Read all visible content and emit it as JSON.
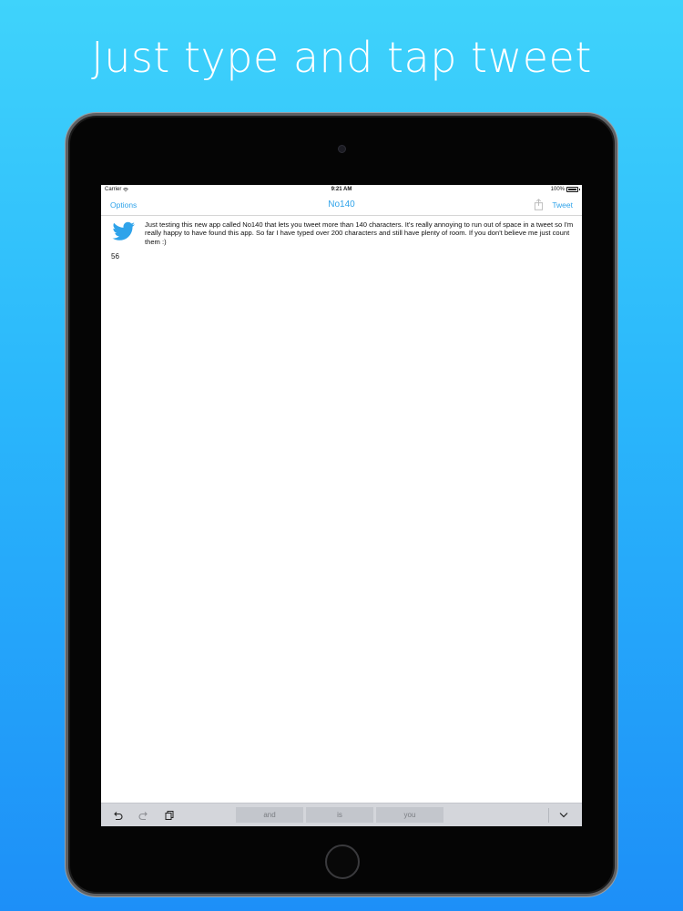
{
  "headline": "Just type and tap tweet",
  "status_bar": {
    "carrier": "Carrier",
    "time": "9:21 AM",
    "battery": "100%"
  },
  "nav_bar": {
    "left_label": "Options",
    "title": "No140",
    "right_label": "Tweet",
    "share_icon": "share-icon"
  },
  "compose": {
    "avatar_icon": "twitter-bird-icon",
    "text": "Just testing this new app called No140 that lets you tweet more than 140 characters. It's really annoying to run out of space in a tweet so I'm really happy to have found this app. So far I have typed over 200 characters and still have plenty of room. If you don't believe me just count them :)",
    "char_count": "56"
  },
  "keyboard_bar": {
    "icons": [
      "undo-icon",
      "redo-icon",
      "paste-icon",
      "chevron-down-icon"
    ],
    "suggestions": [
      "and",
      "is",
      "you"
    ]
  },
  "colors": {
    "accent": "#2fa3ea",
    "background_top": "#3fd3fb",
    "background_bottom": "#1d8ff8",
    "device": "#050505"
  }
}
